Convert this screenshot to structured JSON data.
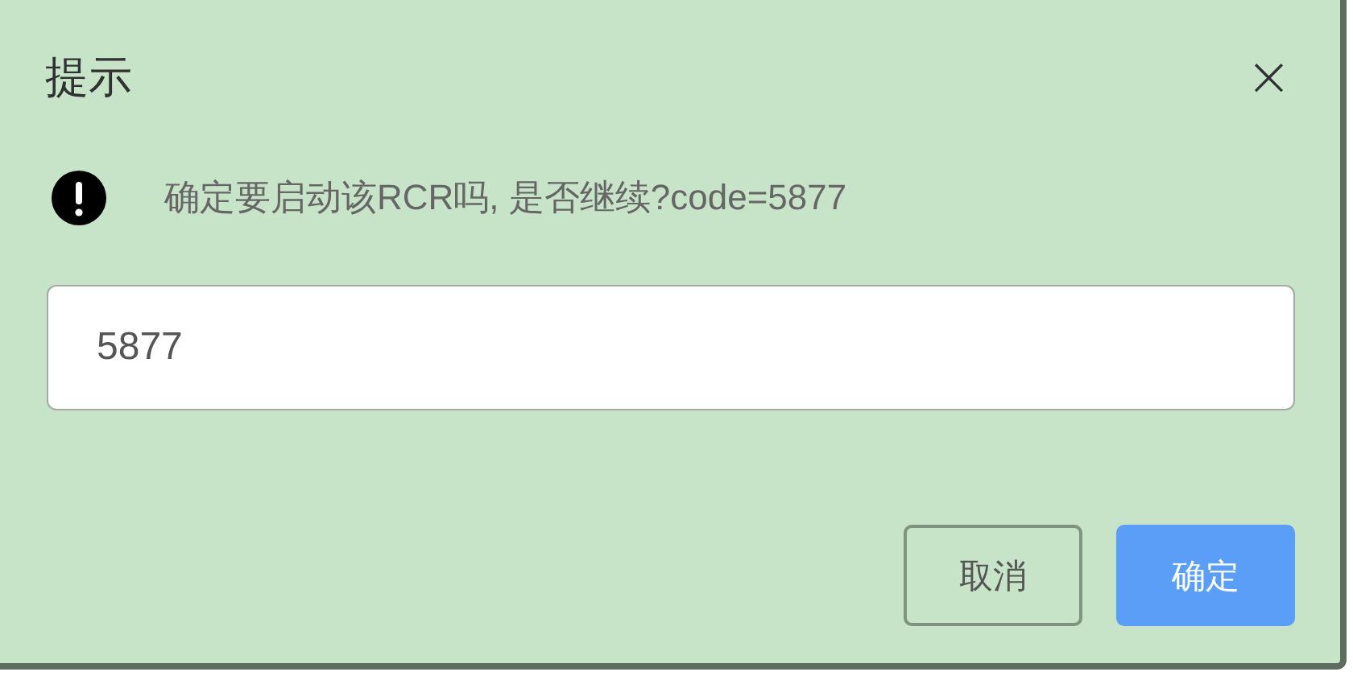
{
  "dialog": {
    "title": "提示",
    "close": "×"
  },
  "message": {
    "text": "确定要启动该RCR吗, 是否继续?code=5877"
  },
  "input": {
    "value": "5877"
  },
  "buttons": [
    {
      "label": "取消",
      "kind": "default"
    },
    {
      "label": "确定",
      "kind": "primary"
    }
  ]
}
